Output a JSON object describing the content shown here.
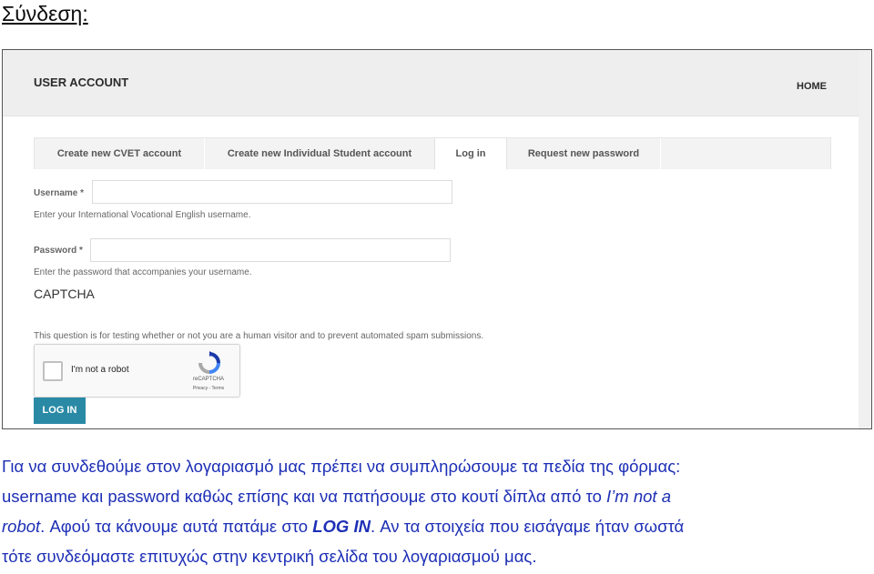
{
  "heading": "Σύνδεση:",
  "site": {
    "title": "USER ACCOUNT",
    "home": "HOME"
  },
  "tabs": [
    {
      "label": "Create new CVET account"
    },
    {
      "label": "Create new Individual Student account"
    },
    {
      "label": "Log in",
      "active": true
    },
    {
      "label": "Request new password"
    }
  ],
  "form": {
    "username_label": "Username",
    "username_value": "",
    "username_help": "Enter your International Vocational English username.",
    "password_label": "Password",
    "password_value": "",
    "password_help": "Enter the password that accompanies your username.",
    "required_mark": "*",
    "captcha_title": "CAPTCHA",
    "captcha_desc": "This question is for testing whether or not you are a human visitor and to prevent automated spam submissions.",
    "recaptcha_checkbox": "I'm not a robot",
    "recaptcha_brand": "reCAPTCHA",
    "recaptcha_privacy": "Privacy - Terms",
    "login_button": "LOG IN"
  },
  "paragraph": {
    "line1": "Για να συνδεθούμε στον λογαριασμό μας πρέπει να συμπληρώσουμε τα πεδία της φόρμας:",
    "line2a": "username και password καθώς επίσης και να πατήσουμε στο κουτί δίπλα από το ",
    "line2b": "I’m not a",
    "line3a": "robot",
    "line3b": ". Αφού τα κάνουμε αυτά πατάμε στο ",
    "line3c": "LOG IN",
    "line3d": ". Αν τα στοιχεία που εισάγαμε ήταν σωστά",
    "line4": "τότε συνδεόμαστε επιτυχώς στην κεντρική σελίδα του λογαριασμού μας."
  },
  "colors": {
    "accent": "#2a8aa6",
    "paragraph_text": "#1d2fb5"
  }
}
